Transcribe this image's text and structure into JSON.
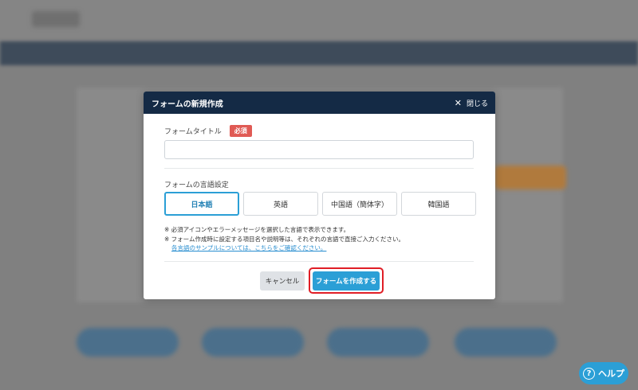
{
  "modal": {
    "title": "フォームの新規作成",
    "close_label": "閉じる",
    "close_icon": "close-icon",
    "form_title_label": "フォームタイトル",
    "required_label": "必須",
    "form_title_value": "",
    "language_label": "フォームの言語設定",
    "languages": [
      {
        "label": "日本語",
        "selected": true
      },
      {
        "label": "英語",
        "selected": false
      },
      {
        "label": "中国語（簡体字）",
        "selected": false
      },
      {
        "label": "韓国語",
        "selected": false
      }
    ],
    "notes": [
      "※ 必須アイコンやエラーメッセージを選択した言語で表示できます。",
      "※ フォーム作成時に設定する項目名や説明等は、それぞれの言語で直接ご入力ください。"
    ],
    "sample_link": "各言語のサンプルについては、こちらをご確認ください。",
    "cancel_label": "キャンセル",
    "create_label": "フォームを作成する"
  },
  "help": {
    "label": "ヘルプ",
    "icon": "question-icon"
  },
  "colors": {
    "header_bg": "#142a45",
    "accent": "#2b9fd6",
    "required": "#e05a54",
    "highlight": "#e01e26"
  }
}
